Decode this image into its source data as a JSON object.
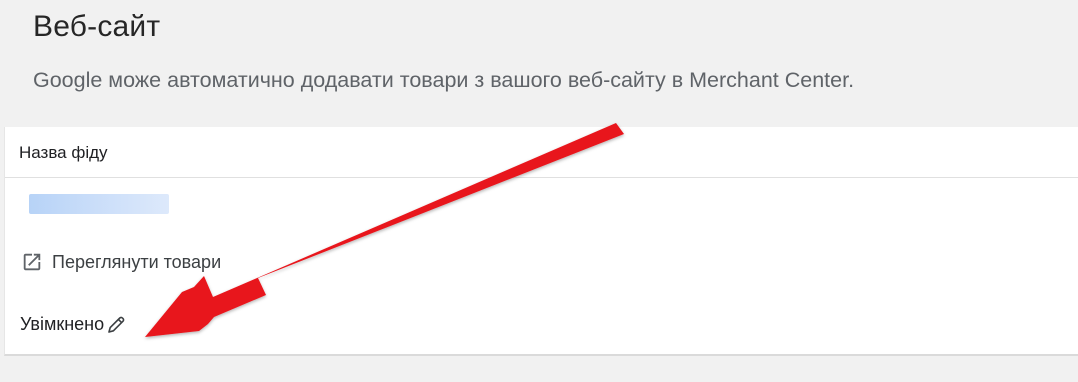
{
  "section": {
    "title": "Веб-сайт",
    "description": "Google може автоматично додавати товари з вашого веб-сайту в Merchant Center."
  },
  "table": {
    "column_header": "Назва фіду",
    "feed_name": "",
    "view_products_label": "Переглянути товари",
    "status_label": "Увімкнено"
  },
  "icons": {
    "view_products": "open-in-new-icon",
    "edit_status": "pencil-icon"
  },
  "colors": {
    "annotation_arrow": "#e8141b",
    "redacted_highlight": "#c9ddf9"
  }
}
